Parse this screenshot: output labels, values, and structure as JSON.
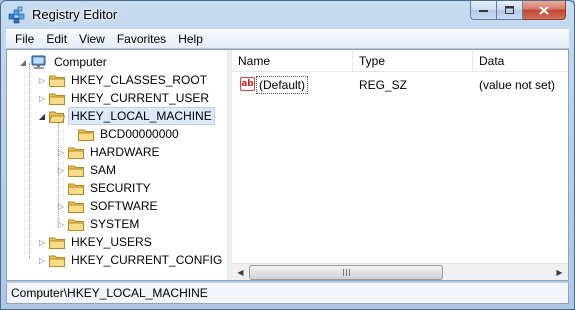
{
  "window": {
    "title": "Registry Editor",
    "app_icon": "registry-editor-icon"
  },
  "menu": [
    "File",
    "Edit",
    "View",
    "Favorites",
    "Help"
  ],
  "tree": {
    "root": "Computer",
    "hives": [
      "HKEY_CLASSES_ROOT",
      "HKEY_CURRENT_USER",
      "HKEY_LOCAL_MACHINE",
      "HKEY_USERS",
      "HKEY_CURRENT_CONFIG"
    ],
    "selected": "HKEY_LOCAL_MACHINE",
    "hklm_children": [
      "BCD00000000",
      "HARDWARE",
      "SAM",
      "SECURITY",
      "SOFTWARE",
      "SYSTEM"
    ]
  },
  "list": {
    "columns": [
      "Name",
      "Type",
      "Data"
    ],
    "rows": [
      {
        "name": "(Default)",
        "type": "REG_SZ",
        "data": "(value not set)",
        "icon": "ab"
      }
    ]
  },
  "status": "Computer\\HKEY_LOCAL_MACHINE",
  "colors": {
    "selection": "#dbe9f8",
    "folder": "#e8c15a",
    "string_icon": "#c22222"
  }
}
